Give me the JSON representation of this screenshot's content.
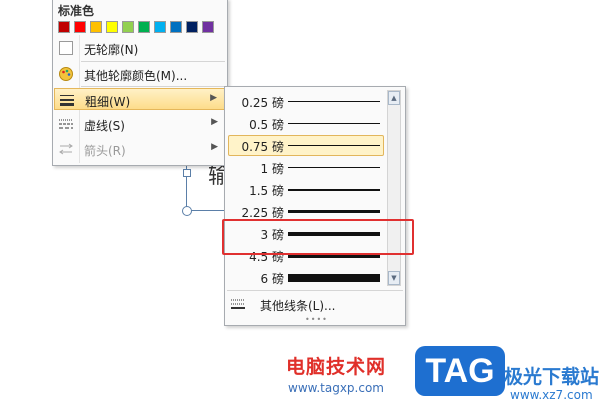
{
  "menu": {
    "section_title": "标准色",
    "swatches": [
      "#c00000",
      "#ff0000",
      "#ffc000",
      "#ffff00",
      "#92d050",
      "#00b050",
      "#00b0f0",
      "#0070c0",
      "#002060",
      "#7030a0"
    ],
    "items": [
      {
        "label": "无轮廓(N)",
        "icon": "no-outline-box-icon"
      },
      {
        "label": "其他轮廓颜色(M)...",
        "icon": "color-palette-icon"
      },
      {
        "label": "粗细(W)",
        "icon": "line-weight-icon"
      },
      {
        "label": "虚线(S)",
        "icon": "dash-line-icon"
      },
      {
        "label": "箭头(R)",
        "icon": "arrow-icon"
      }
    ],
    "highlight_color": "#fddc8a"
  },
  "weights": {
    "items": [
      {
        "label": "0.25 磅",
        "pt": 0.25
      },
      {
        "label": "0.5 磅",
        "pt": 0.5
      },
      {
        "label": "0.75 磅",
        "pt": 0.75,
        "selected": true
      },
      {
        "label": "1 磅",
        "pt": 1
      },
      {
        "label": "1.5 磅",
        "pt": 1.5
      },
      {
        "label": "2.25 磅",
        "pt": 2.25
      },
      {
        "label": "3 磅",
        "pt": 3
      },
      {
        "label": "4.5 磅",
        "pt": 4.5
      },
      {
        "label": "6 磅",
        "pt": 6
      }
    ],
    "more_label": "其他线条(L)...",
    "scroll_up": "▲",
    "scroll_down": "▼"
  },
  "document": {
    "text": "输"
  },
  "annotation_color": "#e03030",
  "watermark": {
    "site_name": "电脑技术网",
    "site_url": "www.tagxp.com",
    "logo_text": "TAG",
    "right_text": "极光下载站",
    "right_url": "www.xz7.com"
  }
}
